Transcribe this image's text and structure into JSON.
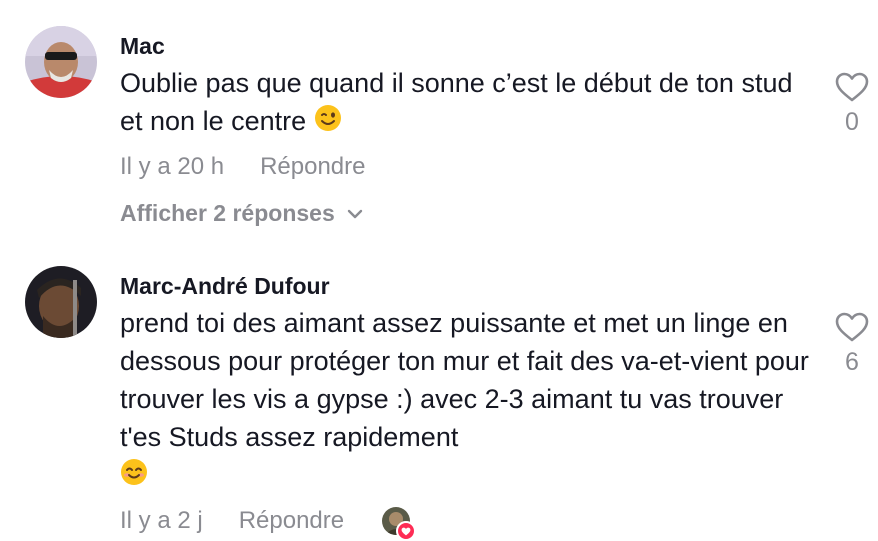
{
  "comments": [
    {
      "author": "Mac",
      "text": "Oublie pas que quand il sonne c’est le début de ton stud et non le centre",
      "emoji": "wink-emoji",
      "time": "Il y a 20 h",
      "reply_label": "Répondre",
      "likes": "0",
      "view_replies": "Afficher 2 réponses"
    },
    {
      "author": "Marc-André Dufour",
      "text": "prend toi des aimant assez puissante et met un linge en dessous pour protéger ton mur et fait des va-et-vient pour trouver les vis a gypse :) avec 2-3 aimant tu vas trouver t'es Studs assez rapidement",
      "emoji": "smile-emoji",
      "time": "Il y a 2 j",
      "reply_label": "Répondre",
      "likes": "6"
    }
  ],
  "colors": {
    "primary_text": "#161823",
    "secondary_text": "#8a8b91",
    "accent": "#fe2c55"
  }
}
